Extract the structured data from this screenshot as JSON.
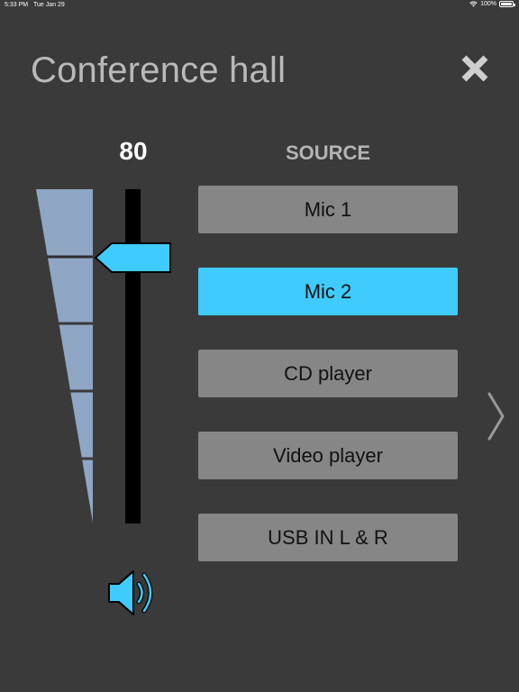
{
  "status_bar": {
    "time": "5:33 PM",
    "date": "Tue Jan 29",
    "battery": "100%"
  },
  "header": {
    "title": "Conference hall",
    "close_icon": "close-icon"
  },
  "volume": {
    "value": "80",
    "level_percent": 80,
    "meter_segments": 5
  },
  "sources": {
    "heading": "SOURCE",
    "items": [
      {
        "label": "Mic 1",
        "selected": false
      },
      {
        "label": "Mic 2",
        "selected": true
      },
      {
        "label": "CD player",
        "selected": false
      },
      {
        "label": "Video player",
        "selected": false
      },
      {
        "label": "USB IN L & R",
        "selected": false
      }
    ]
  },
  "colors": {
    "background": "#3a3a3a",
    "accent": "#3fcbfd",
    "button": "#868686",
    "meter": "#8fa6c4"
  },
  "icons": {
    "next": "chevron-right-icon",
    "speaker": "speaker-icon"
  }
}
